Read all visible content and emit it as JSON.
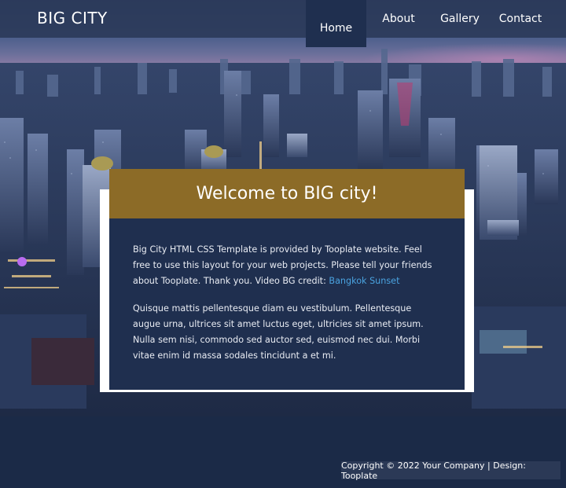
{
  "header": {
    "brand": "BIG CITY",
    "nav": {
      "home": "Home",
      "about": "About",
      "gallery": "Gallery",
      "contact": "Contact"
    }
  },
  "card": {
    "title": "Welcome to BIG city!",
    "paragraph1_text": "Big City HTML CSS Template is provided by Tooplate website. Feel free to use this layout for your web projects. Please tell your friends about Tooplate. Thank you. Video BG credit: ",
    "paragraph1_link": "Bangkok Sunset",
    "paragraph2": "Quisque mattis pellentesque diam eu vestibulum. Pellentesque augue urna, ultrices sit amet luctus eget, ultricies sit amet ipsum. Nulla sem nisi, commodo sed auctor sed, euismod nec dui. Morbi vitae enim id massa sodales tincidunt a et mi."
  },
  "footer": {
    "copyright": "Copyright © 2022 Your Company | Design: Tooplate"
  },
  "colors": {
    "header_bg": "#2c3a5a",
    "active_nav_bg": "#1f2f4f",
    "card_title_bg": "#8c6b27",
    "card_body_bg": "#1f2f4f",
    "link": "#4aa3e0",
    "page_bg": "#1b2a47"
  }
}
